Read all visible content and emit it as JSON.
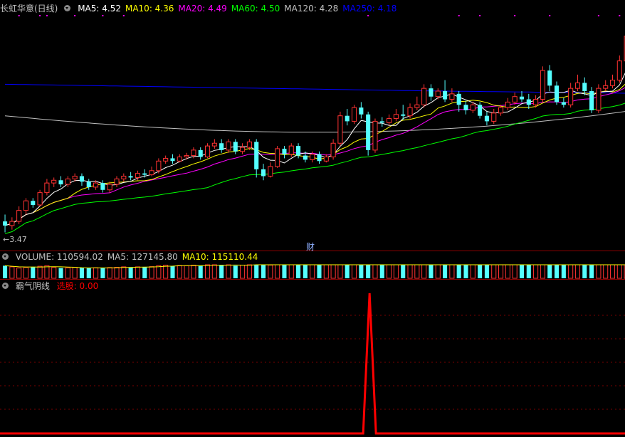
{
  "main_panel": {
    "stock_name": "长虹华意(日线)",
    "ma_legend": [
      {
        "label": "MA5: 4.52",
        "color": "#ffffff"
      },
      {
        "label": "MA10: 4.36",
        "color": "#ffff00"
      },
      {
        "label": "MA20: 4.49",
        "color": "#ff00ff"
      },
      {
        "label": "MA60: 4.50",
        "color": "#00ff00"
      },
      {
        "label": "MA120: 4.28",
        "color": "#c0c0c0"
      },
      {
        "label": "MA250: 4.18",
        "color": "#0000ff"
      }
    ],
    "low_label": "3.47",
    "marker_label": "财"
  },
  "volume_panel": {
    "legend": [
      {
        "label": "VOLUME: 110594.02",
        "color": "#c0c0c0"
      },
      {
        "label": "MA5: 127145.80",
        "color": "#c0c0c0"
      },
      {
        "label": "MA10: 115110.44",
        "color": "#ffff00"
      }
    ]
  },
  "indicator_panel": {
    "name": "霸气阴线",
    "value_label": "选股: 0.00",
    "value_color": "#ff0000"
  },
  "colors": {
    "up": "#ff3232",
    "down": "#54ffff",
    "ma5": "#ffffff",
    "ma10": "#ffff00",
    "ma20": "#ff00ff",
    "ma60": "#00ff00",
    "ma120": "#c0c0c0",
    "ma250": "#0000ff",
    "signal": "#ff0000"
  },
  "chart_data": {
    "type": "candlestick",
    "price_range": [
      3.4,
      5.05
    ],
    "candles": [
      [
        3.55,
        3.52,
        3.6,
        3.47
      ],
      [
        3.52,
        3.55,
        3.58,
        3.49
      ],
      [
        3.55,
        3.63,
        3.66,
        3.53
      ],
      [
        3.63,
        3.7,
        3.72,
        3.6
      ],
      [
        3.7,
        3.67,
        3.72,
        3.65
      ],
      [
        3.67,
        3.76,
        3.78,
        3.66
      ],
      [
        3.76,
        3.83,
        3.86,
        3.74
      ],
      [
        3.83,
        3.85,
        3.87,
        3.8
      ],
      [
        3.85,
        3.82,
        3.88,
        3.8
      ],
      [
        3.82,
        3.86,
        3.88,
        3.8
      ],
      [
        3.86,
        3.88,
        3.9,
        3.84
      ],
      [
        3.88,
        3.84,
        3.9,
        3.81
      ],
      [
        3.84,
        3.8,
        3.86,
        3.78
      ],
      [
        3.8,
        3.83,
        3.85,
        3.78
      ],
      [
        3.83,
        3.78,
        3.85,
        3.76
      ],
      [
        3.78,
        3.82,
        3.84,
        3.76
      ],
      [
        3.82,
        3.86,
        3.88,
        3.8
      ],
      [
        3.86,
        3.88,
        3.9,
        3.84
      ],
      [
        3.88,
        3.87,
        3.91,
        3.85
      ],
      [
        3.87,
        3.9,
        3.92,
        3.85
      ],
      [
        3.9,
        3.89,
        3.93,
        3.87
      ],
      [
        3.89,
        3.92,
        3.95,
        3.88
      ],
      [
        3.92,
        3.99,
        4.01,
        3.9
      ],
      [
        3.99,
        4.01,
        4.03,
        3.97
      ],
      [
        4.01,
        3.99,
        4.04,
        3.97
      ],
      [
        3.99,
        4.02,
        4.04,
        3.98
      ],
      [
        4.02,
        4.03,
        4.05,
        4.0
      ],
      [
        4.03,
        4.07,
        4.09,
        4.01
      ],
      [
        4.07,
        4.02,
        4.09,
        4.0
      ],
      [
        4.02,
        4.1,
        4.12,
        4.01
      ],
      [
        4.1,
        4.12,
        4.15,
        4.08
      ],
      [
        4.12,
        4.07,
        4.15,
        4.05
      ],
      [
        4.07,
        4.13,
        4.15,
        4.05
      ],
      [
        4.13,
        4.06,
        4.15,
        4.04
      ],
      [
        4.06,
        4.09,
        4.12,
        4.04
      ],
      [
        4.09,
        4.13,
        4.15,
        4.07
      ],
      [
        4.13,
        3.93,
        4.15,
        3.87
      ],
      [
        3.93,
        3.88,
        3.97,
        3.85
      ],
      [
        3.88,
        3.95,
        3.98,
        3.87
      ],
      [
        3.95,
        4.08,
        4.1,
        3.94
      ],
      [
        4.08,
        4.04,
        4.1,
        4.01
      ],
      [
        4.04,
        4.1,
        4.12,
        4.02
      ],
      [
        4.1,
        4.03,
        4.12,
        4.01
      ],
      [
        4.03,
        4.0,
        4.06,
        3.98
      ],
      [
        4.0,
        4.04,
        4.06,
        3.98
      ],
      [
        4.04,
        3.99,
        4.06,
        3.97
      ],
      [
        3.99,
        4.02,
        4.04,
        3.98
      ],
      [
        4.02,
        4.12,
        4.15,
        4.0
      ],
      [
        4.12,
        4.32,
        4.35,
        4.1
      ],
      [
        4.32,
        4.28,
        4.37,
        4.25
      ],
      [
        4.28,
        4.38,
        4.4,
        4.26
      ],
      [
        4.38,
        4.33,
        4.42,
        4.3
      ],
      [
        4.33,
        4.07,
        4.35,
        4.03
      ],
      [
        4.07,
        4.28,
        4.3,
        4.05
      ],
      [
        4.28,
        4.27,
        4.31,
        4.24
      ],
      [
        4.27,
        4.3,
        4.33,
        4.25
      ],
      [
        4.3,
        4.33,
        4.37,
        4.28
      ],
      [
        4.33,
        4.32,
        4.4,
        4.29
      ],
      [
        4.32,
        4.38,
        4.41,
        4.3
      ],
      [
        4.38,
        4.4,
        4.46,
        4.36
      ],
      [
        4.4,
        4.52,
        4.55,
        4.38
      ],
      [
        4.52,
        4.46,
        4.55,
        4.43
      ],
      [
        4.46,
        4.5,
        4.52,
        4.44
      ],
      [
        4.5,
        4.44,
        4.58,
        4.42
      ],
      [
        4.44,
        4.48,
        4.52,
        4.42
      ],
      [
        4.48,
        4.4,
        4.5,
        4.35
      ],
      [
        4.4,
        4.36,
        4.43,
        4.33
      ],
      [
        4.36,
        4.4,
        4.42,
        4.34
      ],
      [
        4.4,
        4.32,
        4.42,
        4.3
      ],
      [
        4.32,
        4.28,
        4.35,
        4.25
      ],
      [
        4.28,
        4.34,
        4.37,
        4.26
      ],
      [
        4.34,
        4.38,
        4.4,
        4.32
      ],
      [
        4.38,
        4.42,
        4.45,
        4.36
      ],
      [
        4.42,
        4.46,
        4.49,
        4.4
      ],
      [
        4.46,
        4.44,
        4.5,
        4.42
      ],
      [
        4.44,
        4.4,
        4.48,
        4.37
      ],
      [
        4.4,
        4.44,
        4.47,
        4.38
      ],
      [
        4.44,
        4.65,
        4.68,
        4.42
      ],
      [
        4.65,
        4.54,
        4.69,
        4.5
      ],
      [
        4.54,
        4.42,
        4.57,
        4.4
      ],
      [
        4.42,
        4.4,
        4.45,
        4.38
      ],
      [
        4.4,
        4.52,
        4.56,
        4.38
      ],
      [
        4.52,
        4.56,
        4.62,
        4.5
      ],
      [
        4.56,
        4.5,
        4.6,
        4.47
      ],
      [
        4.5,
        4.36,
        4.53,
        4.34
      ],
      [
        4.36,
        4.52,
        4.55,
        4.34
      ],
      [
        4.52,
        4.54,
        4.58,
        4.5
      ],
      [
        4.54,
        4.58,
        4.62,
        4.52
      ],
      [
        4.58,
        4.72,
        4.76,
        4.56
      ],
      [
        4.72,
        4.9,
        4.95,
        4.7
      ]
    ],
    "volume": [
      110,
      100,
      90,
      95,
      100,
      105,
      110,
      95,
      90,
      92,
      95,
      90,
      88,
      92,
      90,
      94,
      96,
      100,
      95,
      100,
      98,
      102,
      110,
      115,
      108,
      112,
      110,
      115,
      108,
      118,
      120,
      112,
      118,
      110,
      115,
      120,
      140,
      120,
      115,
      130,
      125,
      128,
      122,
      118,
      120,
      115,
      118,
      130,
      160,
      170,
      165,
      175,
      180,
      150,
      140,
      150,
      155,
      160,
      165,
      170,
      180,
      150,
      148,
      160,
      150,
      140,
      138,
      142,
      140,
      135,
      145,
      150,
      155,
      160,
      150,
      140,
      145,
      170,
      150,
      135,
      130,
      150,
      155,
      145,
      130,
      150,
      140,
      145,
      150,
      155
    ],
    "volume_range": [
      0,
      260
    ],
    "indicator": {
      "name": "霸气阴线",
      "value": 0.0,
      "signal_index": 52,
      "range": [
        0,
        1
      ]
    }
  }
}
